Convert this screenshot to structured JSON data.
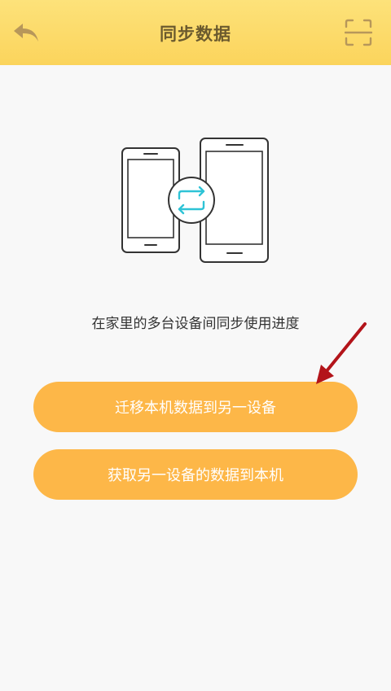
{
  "header": {
    "title": "同步数据",
    "back_icon": "back-arrow-icon",
    "scan_icon": "scan-icon",
    "background_color": "#fbd45c",
    "icon_color": "#b7975a"
  },
  "illustration": {
    "icon": "phone-sync-illustration",
    "sync_color": "#2ec3d6"
  },
  "description": "在家里的多台设备间同步使用进度",
  "buttons": {
    "migrate_label": "迁移本机数据到另一设备",
    "fetch_label": "获取另一设备的数据到本机",
    "color": "#fdb748"
  },
  "annotation": {
    "icon": "red-arrow-annotation",
    "color": "#b3141a"
  }
}
